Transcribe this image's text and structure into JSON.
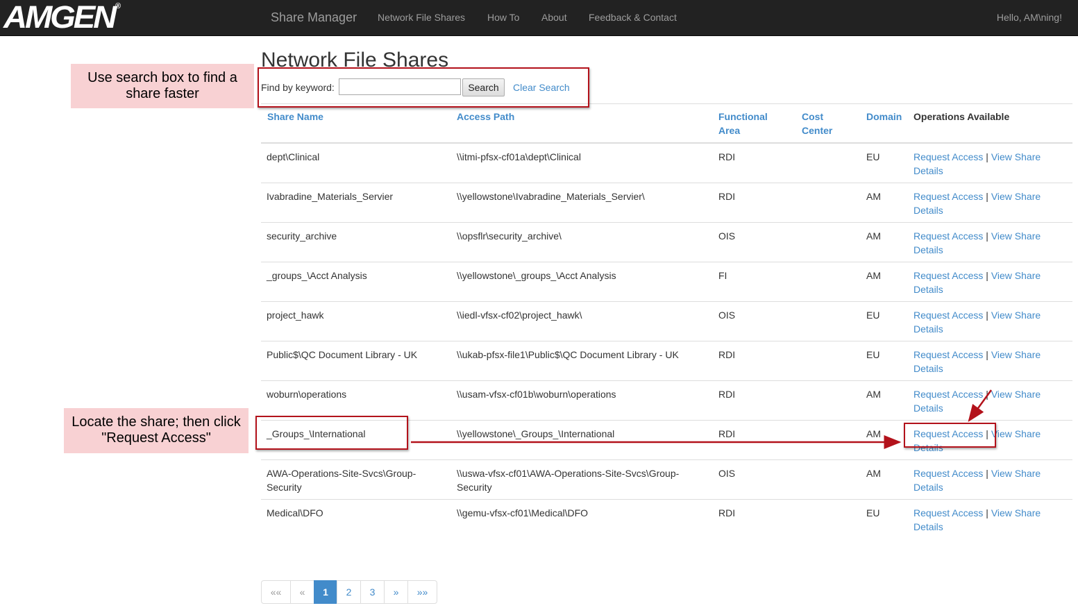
{
  "navbar": {
    "logo_text": "AMGEN",
    "logo_mark": "®",
    "brand": "Share Manager",
    "links": [
      "Network File Shares",
      "How To",
      "About",
      "Feedback & Contact"
    ],
    "greeting": "Hello, AM\\ning!"
  },
  "page_title": "Network File Shares",
  "search": {
    "label": "Find by keyword:",
    "value": "",
    "placeholder": "",
    "button": "Search",
    "clear": "Clear Search"
  },
  "table": {
    "headers": {
      "share_name": "Share Name",
      "access_path": "Access Path",
      "functional_area_1": "Functional",
      "functional_area_2": "Area",
      "cost_center_1": "Cost",
      "cost_center_2": "Center",
      "domain": "Domain",
      "operations": "Operations Available"
    },
    "ops": {
      "request": "Request Access",
      "separator": "|",
      "view1": "View Share",
      "view2": "Details"
    },
    "rows": [
      {
        "name": "dept\\Clinical",
        "path": "\\\\itmi-pfsx-cf01a\\dept\\Clinical",
        "area": "RDI",
        "domain": "EU"
      },
      {
        "name": "Ivabradine_Materials_Servier",
        "path": "\\\\yellowstone\\Ivabradine_Materials_Servier\\",
        "area": "RDI",
        "domain": "AM"
      },
      {
        "name": "security_archive",
        "path": "\\\\opsflr\\security_archive\\",
        "area": "OIS",
        "domain": "AM"
      },
      {
        "name": "_groups_\\Acct Analysis",
        "path": "\\\\yellowstone\\_groups_\\Acct Analysis",
        "area": "FI",
        "domain": "AM"
      },
      {
        "name": "project_hawk",
        "path": "\\\\iedl-vfsx-cf02\\project_hawk\\",
        "area": "OIS",
        "domain": "EU"
      },
      {
        "name": "Public$\\QC Document Library - UK",
        "path": "\\\\ukab-pfsx-file1\\Public$\\QC Document Library - UK",
        "area": "RDI",
        "domain": "EU"
      },
      {
        "name": "woburn\\operations",
        "path": "\\\\usam-vfsx-cf01b\\woburn\\operations",
        "area": "RDI",
        "domain": "AM"
      },
      {
        "name": "_Groups_\\International",
        "path": "\\\\yellowstone\\_Groups_\\International",
        "area": "RDI",
        "domain": "AM"
      },
      {
        "name": "AWA-Operations-Site-Svcs\\Group-Security",
        "path": "\\\\uswa-vfsx-cf01\\AWA-Operations-Site-Svcs\\Group-Security",
        "area": "OIS",
        "domain": "AM"
      },
      {
        "name": "Medical\\DFO",
        "path": "\\\\gemu-vfsx-cf01\\Medical\\DFO",
        "area": "RDI",
        "domain": "EU"
      }
    ]
  },
  "callouts": {
    "search": "Use search box to find a share faster",
    "locate": "Locate the share; then click \"Request Access\""
  },
  "pagination": {
    "first": "««",
    "prev": "«",
    "pages": [
      "1",
      "2",
      "3"
    ],
    "active_page": "1",
    "next": "»",
    "last": "»»"
  },
  "colors": {
    "navbar_bg": "#222222",
    "link": "#428bca",
    "callout_bg": "#f8d1d3",
    "annotation_red": "#b3121b"
  }
}
